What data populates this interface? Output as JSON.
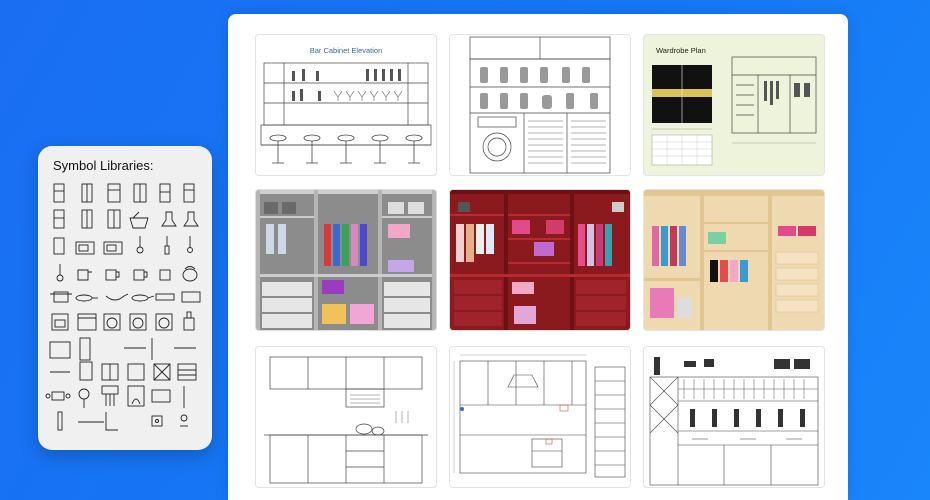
{
  "library": {
    "title": "Symbol Libraries:"
  },
  "templates": {
    "bar_cabinet": {
      "title": "Bar Cabinet Elevation"
    },
    "wardrobe_plan": {
      "title": "Wardrobe Plan"
    }
  },
  "colors": {
    "background": "#1478f5",
    "gray_closet": "#8c8c8c",
    "red_closet": "#8b1a1f",
    "wood_closet": "#efd9b0",
    "plan_bg": "#eef3dc",
    "bar_title": "#2a6fb5"
  }
}
